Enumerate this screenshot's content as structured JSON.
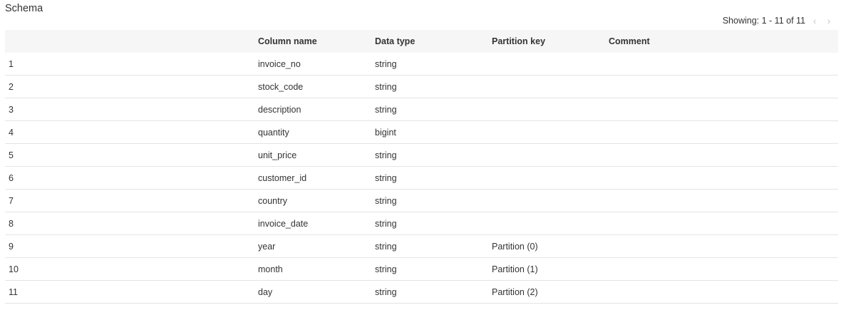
{
  "section": {
    "title": "Schema"
  },
  "pager": {
    "text": "Showing: 1 - 11 of 11",
    "prev_glyph": "‹",
    "next_glyph": "›"
  },
  "table": {
    "headers": {
      "index": "",
      "column_name": "Column name",
      "data_type": "Data type",
      "partition_key": "Partition key",
      "comment": "Comment"
    },
    "rows": [
      {
        "index": "1",
        "column_name": "invoice_no",
        "data_type": "string",
        "partition_key": "",
        "comment": ""
      },
      {
        "index": "2",
        "column_name": "stock_code",
        "data_type": "string",
        "partition_key": "",
        "comment": ""
      },
      {
        "index": "3",
        "column_name": "description",
        "data_type": "string",
        "partition_key": "",
        "comment": ""
      },
      {
        "index": "4",
        "column_name": "quantity",
        "data_type": "bigint",
        "partition_key": "",
        "comment": ""
      },
      {
        "index": "5",
        "column_name": "unit_price",
        "data_type": "string",
        "partition_key": "",
        "comment": ""
      },
      {
        "index": "6",
        "column_name": "customer_id",
        "data_type": "string",
        "partition_key": "",
        "comment": ""
      },
      {
        "index": "7",
        "column_name": "country",
        "data_type": "string",
        "partition_key": "",
        "comment": ""
      },
      {
        "index": "8",
        "column_name": "invoice_date",
        "data_type": "string",
        "partition_key": "",
        "comment": ""
      },
      {
        "index": "9",
        "column_name": "year",
        "data_type": "string",
        "partition_key": "Partition (0)",
        "comment": ""
      },
      {
        "index": "10",
        "column_name": "month",
        "data_type": "string",
        "partition_key": "Partition (1)",
        "comment": ""
      },
      {
        "index": "11",
        "column_name": "day",
        "data_type": "string",
        "partition_key": "Partition (2)",
        "comment": ""
      }
    ]
  },
  "colors": {
    "header_bg": "#f6f6f6",
    "row_border": "#e4e4e4",
    "text": "#333333",
    "pager_disabled": "#c8c8c8"
  }
}
